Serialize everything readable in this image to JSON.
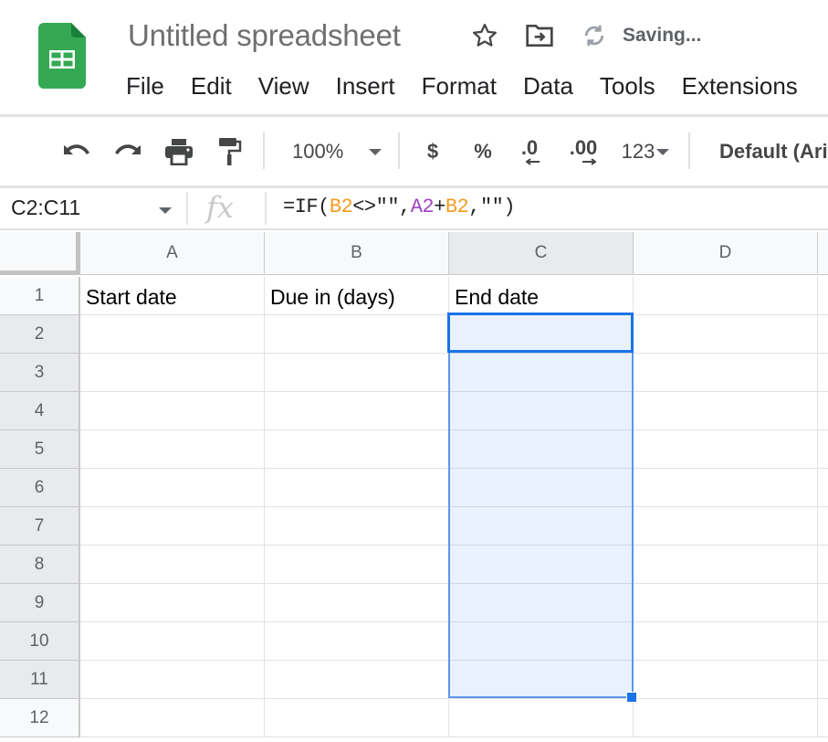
{
  "app": {
    "doc_title": "Untitled spreadsheet",
    "save_status": "Saving...",
    "brand_color": "#34a853",
    "accent_color": "#1a73e8",
    "title_icons": [
      "star-icon",
      "move-to-folder-icon",
      "sync-icon"
    ]
  },
  "menu": {
    "items": [
      {
        "label": "File"
      },
      {
        "label": "Edit"
      },
      {
        "label": "View"
      },
      {
        "label": "Insert"
      },
      {
        "label": "Format"
      },
      {
        "label": "Data"
      },
      {
        "label": "Tools"
      },
      {
        "label": "Extensions"
      }
    ]
  },
  "toolbar": {
    "undo_icon": "undo-icon",
    "redo_icon": "redo-icon",
    "print_icon": "print-icon",
    "paint_format_icon": "paint-format-icon",
    "zoom": "100%",
    "currency": "$",
    "percent": "%",
    "decrease_decimal": ".0",
    "increase_decimal": ".00",
    "more_formats": "123",
    "font": "Default (Ari"
  },
  "formula_bar": {
    "name_box": "C2:C11",
    "fx_label": "fx",
    "formula_parts": [
      {
        "text": "=IF(",
        "type": "plain"
      },
      {
        "text": "B2",
        "type": "ref",
        "color": "#f29b22"
      },
      {
        "text": "<>\"\",",
        "type": "plain"
      },
      {
        "text": "A2",
        "type": "ref",
        "color": "#a142c4"
      },
      {
        "text": "+",
        "type": "plain"
      },
      {
        "text": "B2",
        "type": "ref",
        "color": "#f29b22"
      },
      {
        "text": ",\"\")",
        "type": "plain"
      }
    ]
  },
  "grid": {
    "columns": [
      "A",
      "B",
      "C",
      "D"
    ],
    "rows": [
      "1",
      "2",
      "3",
      "4",
      "5",
      "6",
      "7",
      "8",
      "9",
      "10",
      "11",
      "12"
    ],
    "cells": {
      "A1": "Start date",
      "B1": "Due in (days)",
      "C1": "End date"
    },
    "selection": {
      "range": "C2:C11",
      "active_cell": "C2",
      "active_column": "C",
      "active_rows": [
        "2",
        "3",
        "4",
        "5",
        "6",
        "7",
        "8",
        "9",
        "10",
        "11"
      ]
    }
  }
}
